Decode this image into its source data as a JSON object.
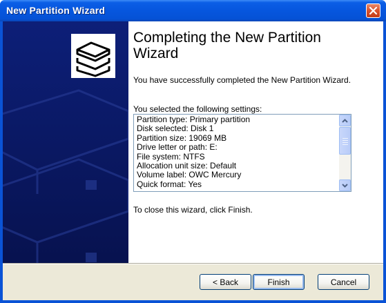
{
  "window": {
    "title": "New Partition Wizard"
  },
  "wizard": {
    "heading": "Completing the New Partition Wizard",
    "success_message": "You have successfully completed the New Partition Wizard.",
    "settings_label": "You selected the following settings:",
    "settings": [
      "Partition type: Primary partition",
      "Disk selected: Disk 1",
      "Partition size: 19069 MB",
      "Drive letter or path: E:",
      "File system: NTFS",
      "Allocation unit size: Default",
      "Volume label: OWC Mercury",
      "Quick format: Yes"
    ],
    "close_instruction": "To close this wizard, click Finish."
  },
  "buttons": {
    "back": "< Back",
    "finish": "Finish",
    "cancel": "Cancel"
  },
  "icons": {
    "close": "close-icon",
    "disk_logo": "disk-stack-icon",
    "scroll_up": "chevron-up-icon",
    "scroll_down": "chevron-down-icon"
  },
  "colors": {
    "titlebar": "#0656de",
    "side_panel": "#0a1a6e",
    "close_button": "#d9522c",
    "button_face": "#ece9d8"
  }
}
